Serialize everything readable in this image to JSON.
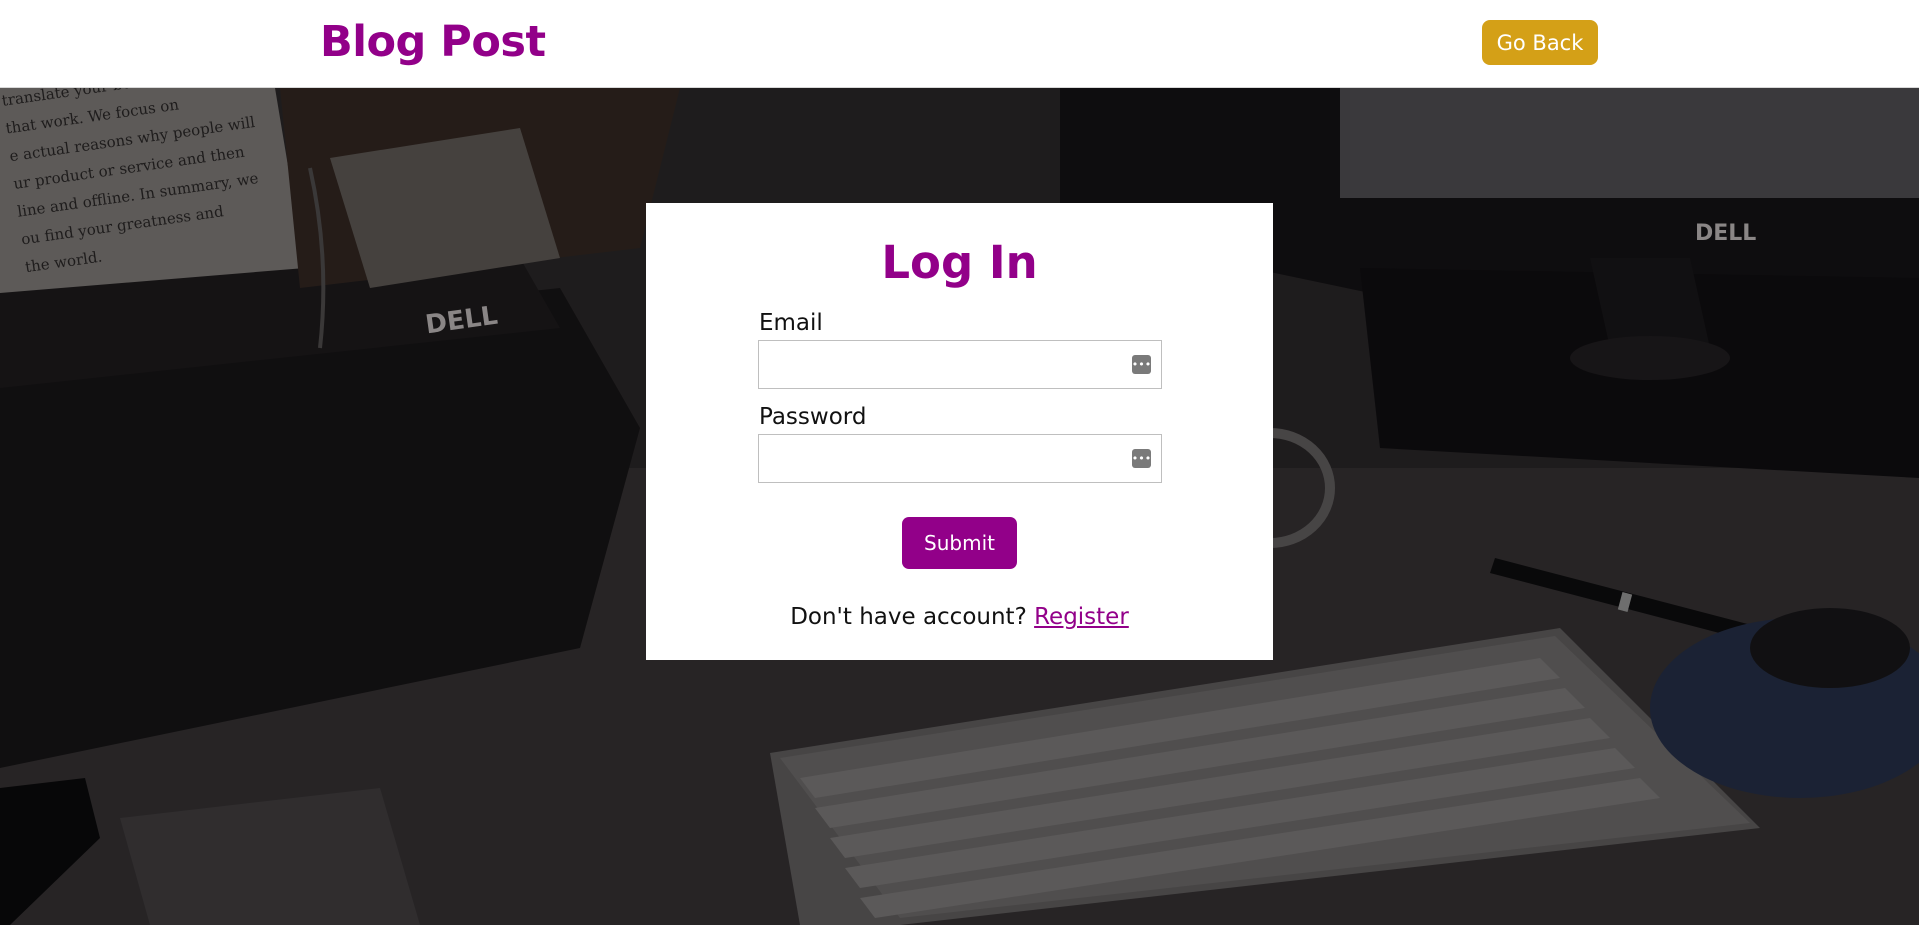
{
  "header": {
    "brand": "Blog Post",
    "go_back_label": "Go Back"
  },
  "login": {
    "title": "Log In",
    "email_label": "Email",
    "email_value": "",
    "password_label": "Password",
    "password_value": "",
    "submit_label": "Submit",
    "no_account_text": "Don't have account?",
    "register_label": "Register"
  },
  "background_text": {
    "document_lines": [
      "translate your business g",
      "that work. We focus on",
      "e actual reasons why people will",
      "ur product or service and then",
      "line and offline. In summary, we",
      "ou find your greatness and",
      "the world."
    ],
    "monitor_brand": "DELL"
  },
  "colors": {
    "brand": "#920089",
    "go_back": "#d4a017",
    "submit": "#920089",
    "overlay": "#2e2a2c"
  },
  "icons": {
    "field_autofill": "autofill-key-icon"
  }
}
